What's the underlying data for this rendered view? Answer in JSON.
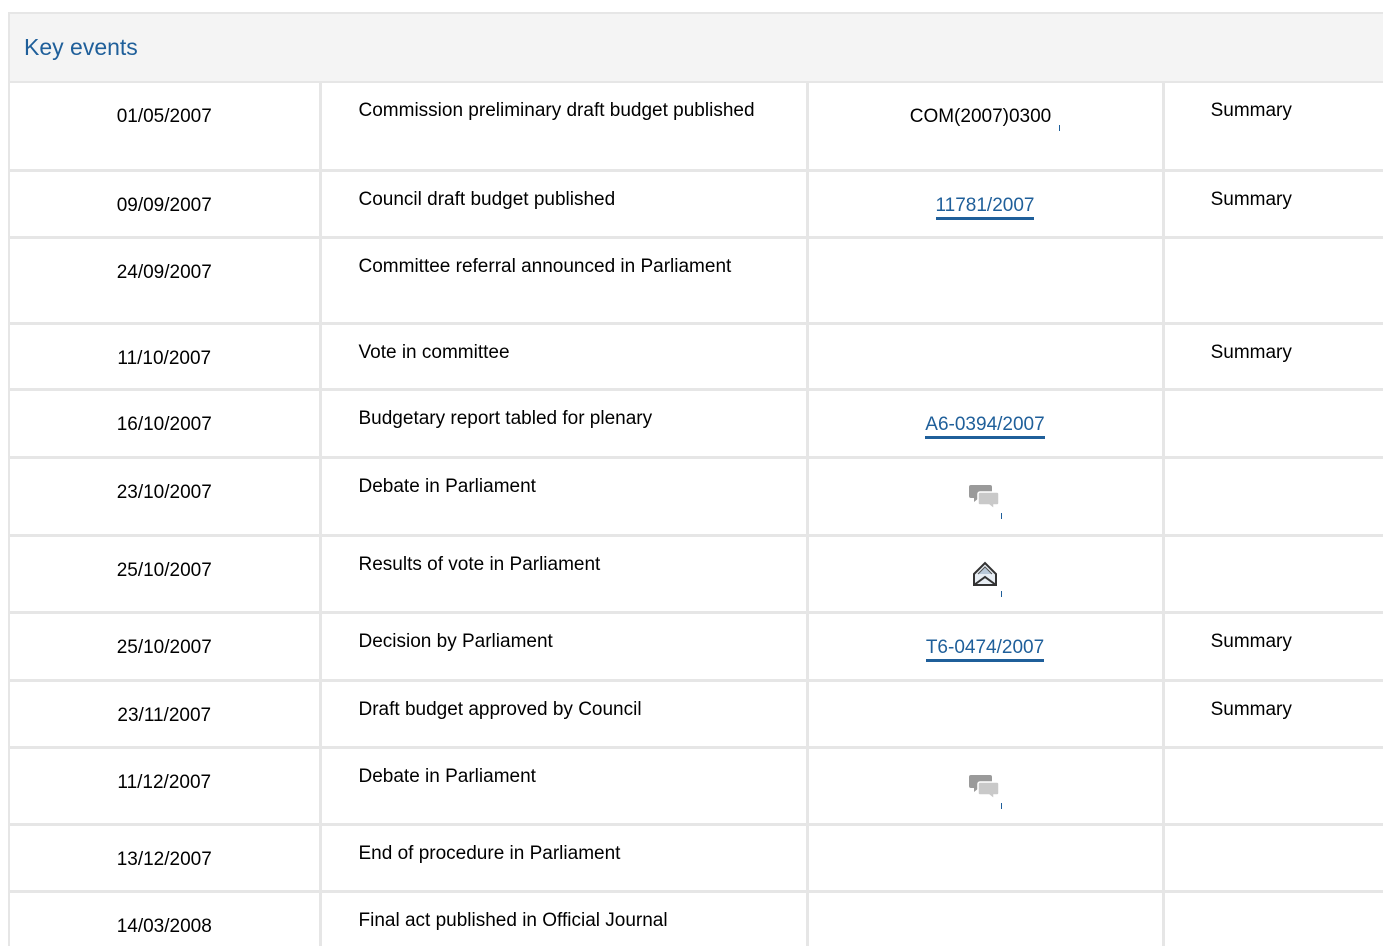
{
  "section": {
    "title": "Key events"
  },
  "rows": [
    {
      "date": "01/05/2007",
      "event": "Commission preliminary draft budget published",
      "ref": "COM(2007)0300",
      "ref_type": "plain",
      "summary": "Summary"
    },
    {
      "date": "09/09/2007",
      "event": "Council draft budget published",
      "ref": "11781/2007",
      "ref_type": "link",
      "summary": "Summary"
    },
    {
      "date": "24/09/2007",
      "event": "Committee referral announced in Parliament",
      "ref": "",
      "ref_type": "none",
      "summary": ""
    },
    {
      "date": "11/10/2007",
      "event": "Vote in committee",
      "ref": "",
      "ref_type": "none",
      "summary": "Summary"
    },
    {
      "date": "16/10/2007",
      "event": "Budgetary report tabled for plenary",
      "ref": "A6-0394/2007",
      "ref_type": "link",
      "summary": ""
    },
    {
      "date": "23/10/2007",
      "event": "Debate in Parliament",
      "ref": "",
      "ref_type": "icon",
      "icon": "debate-icon",
      "summary": ""
    },
    {
      "date": "25/10/2007",
      "event": "Results of vote in Parliament",
      "ref": "",
      "ref_type": "icon",
      "icon": "vote-results-icon",
      "summary": ""
    },
    {
      "date": "25/10/2007",
      "event": "Decision by Parliament",
      "ref": "T6-0474/2007",
      "ref_type": "link",
      "summary": "Summary"
    },
    {
      "date": "23/11/2007",
      "event": "Draft budget approved by Council",
      "ref": "",
      "ref_type": "none",
      "summary": "Summary"
    },
    {
      "date": "11/12/2007",
      "event": "Debate in Parliament",
      "ref": "",
      "ref_type": "icon",
      "icon": "debate-icon",
      "summary": ""
    },
    {
      "date": "13/12/2007",
      "event": "End of procedure in Parliament",
      "ref": "",
      "ref_type": "none",
      "summary": ""
    },
    {
      "date": "14/03/2008",
      "event": "Final act published in Official Journal",
      "ref": "",
      "ref_type": "none",
      "summary": ""
    }
  ],
  "colors": {
    "link": "#1f5f9a",
    "border": "#e6e6e6",
    "header_bg": "#f4f4f4"
  }
}
